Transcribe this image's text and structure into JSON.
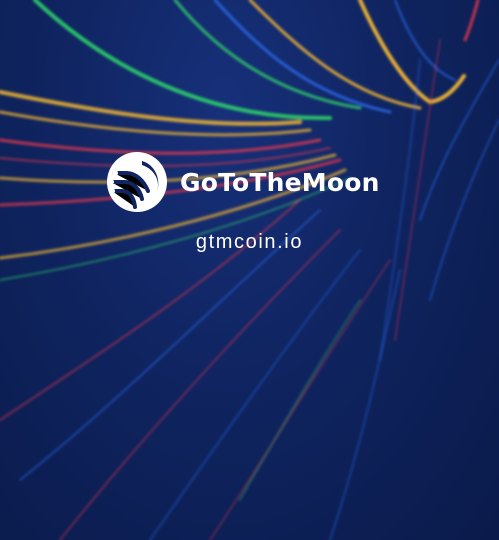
{
  "banner": {
    "brand_name": "GoToTheMoon",
    "domain": "gtmcoin.io",
    "logo_icon": "moon-orbit-logo-icon"
  },
  "colors": {
    "background": "#0f2460",
    "text": "#ffffff",
    "streak_yellow": "#f2b632",
    "streak_green": "#2fd06b",
    "streak_blue": "#2f74ff",
    "streak_red": "#e0374d"
  }
}
